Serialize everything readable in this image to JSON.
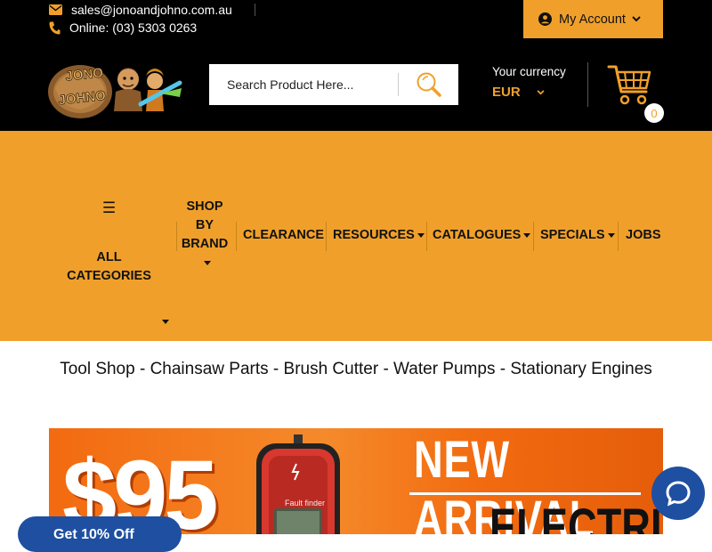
{
  "topbar": {
    "email": "sales@jonoandjohno.com.au",
    "phone": "Online: (03) 5303 0263",
    "account_label": "My Account"
  },
  "header": {
    "logo_text_1": "JONO",
    "logo_text_2": "JOHNO",
    "search_placeholder": "Search Product Here...",
    "currency_label": "Your currency",
    "currency_value": "EUR",
    "cart_count": "0"
  },
  "nav": {
    "all_categories_line1": "ALL",
    "all_categories_line2": "CATEGORIES",
    "shop_line1": "SHOP",
    "shop_line2": "BY",
    "shop_line3": "BRAND",
    "clearance": "CLEARANCE",
    "resources": "RESOURCES",
    "catalogues": "CATALOGUES",
    "specials": "SPECIALS",
    "jobs": "JOBS"
  },
  "tagline": "Tool Shop - Chainsaw Parts - Brush Cutter - Water Pumps - Stationary Engines",
  "banner": {
    "price": "$95",
    "device_label": "Fault finder",
    "headline_1": "NEW ARRIVAL",
    "headline_2": "ELECTRIC"
  },
  "promo": {
    "label": "Get 10% Off"
  },
  "colors": {
    "accent": "#f0a02a",
    "dark": "#000000",
    "chat": "#1f4fa0"
  }
}
